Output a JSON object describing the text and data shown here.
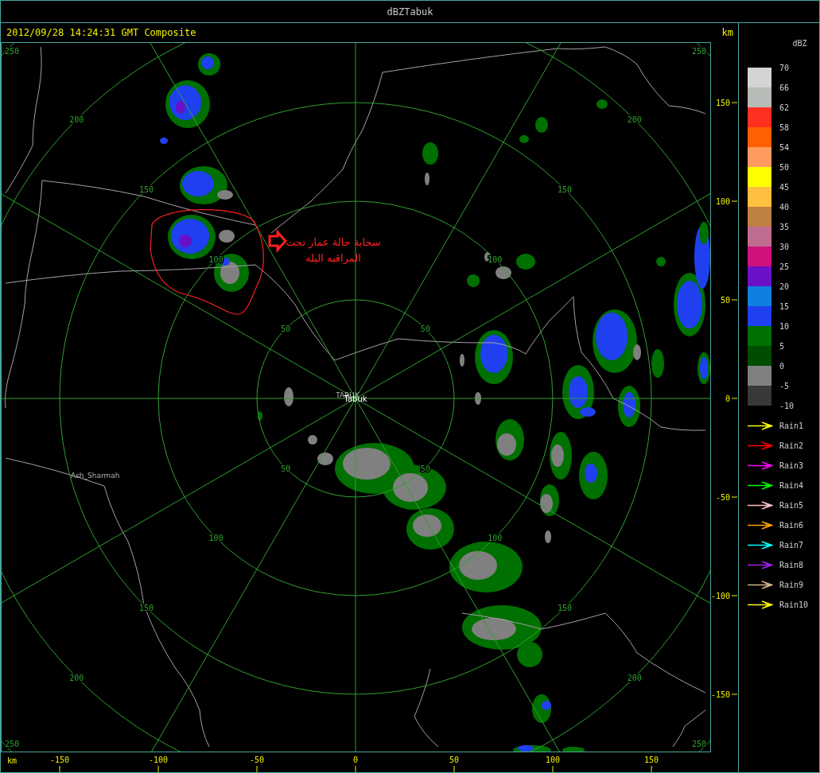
{
  "window": {
    "title": "dBZTabuk"
  },
  "header": {
    "timestamp": "2012/09/28 14:24:31 GMT Composite",
    "unit": "km"
  },
  "map": {
    "range_rings": [
      {
        "nw": "50",
        "ne": "50",
        "sw": "50",
        "se": "50"
      },
      {
        "nw": "100",
        "ne": "100",
        "sw": "100",
        "se": "100"
      },
      {
        "nw": "150",
        "ne": "150",
        "sw": "150",
        "se": "150"
      },
      {
        "nw": "200",
        "ne": "200",
        "sw": "200",
        "se": "200"
      },
      {
        "nw": "250",
        "ne": "250",
        "sw": "250",
        "se": "250"
      }
    ],
    "places": [
      {
        "kind": "station",
        "name": "TABUK"
      },
      {
        "kind": "city",
        "name": "Tabuk"
      },
      {
        "kind": "station",
        "name": "Ash_Sharmah"
      }
    ],
    "annotation": {
      "lines": [
        "سحابة حالة عمار تحت",
        "المراقبه اليله"
      ]
    }
  },
  "y_axis": {
    "ticks": [
      "150",
      "100",
      "50",
      "0",
      "-50",
      "-100",
      "-150"
    ]
  },
  "x_axis": {
    "unit": "km",
    "ticks": [
      "-150",
      "-100",
      "-50",
      "0",
      "50",
      "100",
      "150"
    ]
  },
  "legend": {
    "title": "dBZ",
    "labels": [
      "70",
      "66",
      "62",
      "58",
      "54",
      "50",
      "45",
      "40",
      "35",
      "30",
      "25",
      "20",
      "15",
      "10",
      "5",
      "0",
      "-5",
      "-10"
    ],
    "bins": [
      {
        "color": "#d4d4d4"
      },
      {
        "color": "#b8bcb8"
      },
      {
        "color": "#ff3020"
      },
      {
        "color": "#ff6000"
      },
      {
        "color": "#ff9a60"
      },
      {
        "color": "#ffff00"
      },
      {
        "color": "#ffc040"
      },
      {
        "color": "#c08040"
      },
      {
        "color": "#c06c90"
      },
      {
        "color": "#d0107c"
      },
      {
        "color": "#6a10c8"
      },
      {
        "color": "#1080e0"
      },
      {
        "color": "#2040f0"
      },
      {
        "color": "#007000"
      },
      {
        "color": "#004c00"
      },
      {
        "color": "#808080"
      },
      {
        "color": "#383838"
      }
    ]
  },
  "rain_tracks": [
    {
      "label": "Rain1",
      "color": "#ffff00"
    },
    {
      "label": "Rain2",
      "color": "#ff0000"
    },
    {
      "label": "Rain3",
      "color": "#ff00ff"
    },
    {
      "label": "Rain4",
      "color": "#00ff00"
    },
    {
      "label": "Rain5",
      "color": "#ffc0c8"
    },
    {
      "label": "Rain6",
      "color": "#ffa000"
    },
    {
      "label": "Rain7",
      "color": "#00ffff"
    },
    {
      "label": "Rain8",
      "color": "#a020f0"
    },
    {
      "label": "Rain9",
      "color": "#d2b48c"
    },
    {
      "label": "Rain10",
      "color": "#ffff00"
    }
  ]
}
